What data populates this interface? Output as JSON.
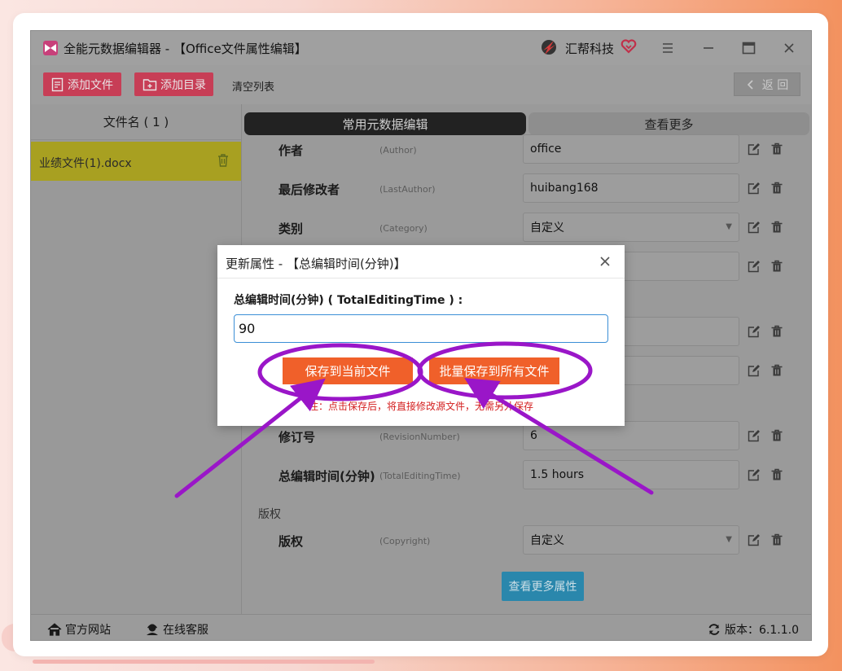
{
  "window": {
    "title": "全能元数据编辑器 - 【Office文件属性编辑】",
    "brand": "汇帮科技"
  },
  "toolbar": {
    "add_file": "添加文件",
    "add_dir": "添加目录",
    "clear_list": "清空列表",
    "back": "返 回"
  },
  "file_list": {
    "header": "文件名 ( 1 )",
    "items": [
      {
        "name": "业绩文件(1).docx"
      }
    ]
  },
  "tabs": {
    "common": "常用元数据编辑",
    "more": "查看更多"
  },
  "properties": [
    {
      "name": "作者",
      "key": "(Author)",
      "value": "office"
    },
    {
      "name": "最后修改者",
      "key": "(LastAuthor)",
      "value": "huibang168"
    },
    {
      "name": "类别",
      "key": "(Category)",
      "value": "自定义"
    },
    {
      "name": "修订号",
      "key": "(RevisionNumber)",
      "value": "6"
    },
    {
      "name": "总编辑时间(分钟)",
      "key": "(TotalEditingTime)",
      "value": "1.5 hours"
    },
    {
      "name": "版权",
      "key": "(Copyright)",
      "value": "自定义"
    }
  ],
  "sections": {
    "copyright": "版权"
  },
  "more_props_button": "查看更多属性",
  "statusbar": {
    "website": "官方网站",
    "support": "在线客服",
    "version": "版本：6.1.1.0"
  },
  "dialog": {
    "title": "更新属性 - 【总编辑时间(分钟)】",
    "label": "总编辑时间(分钟) ( TotalEditingTime ) :",
    "input_value": "90",
    "save_current": "保存到当前文件",
    "save_all": "批量保存到所有文件",
    "note": "注：点击保存后，将直接修改源文件，无需另外保存"
  },
  "colors": {
    "accent_red": "#c73e56",
    "dialog_button": "#f0602a",
    "annotation_purple": "#9a16c8",
    "file_highlight": "#a8a021",
    "more_button": "#2a87ac"
  },
  "icons": [
    "app-logo-icon",
    "brand-logo-icon",
    "heart-icon",
    "menu-icon",
    "minimize-icon",
    "maximize-icon",
    "close-icon",
    "add-file-icon",
    "add-folder-icon",
    "back-chevron-icon",
    "trash-icon",
    "edit-icon",
    "home-icon",
    "support-icon",
    "refresh-icon"
  ]
}
